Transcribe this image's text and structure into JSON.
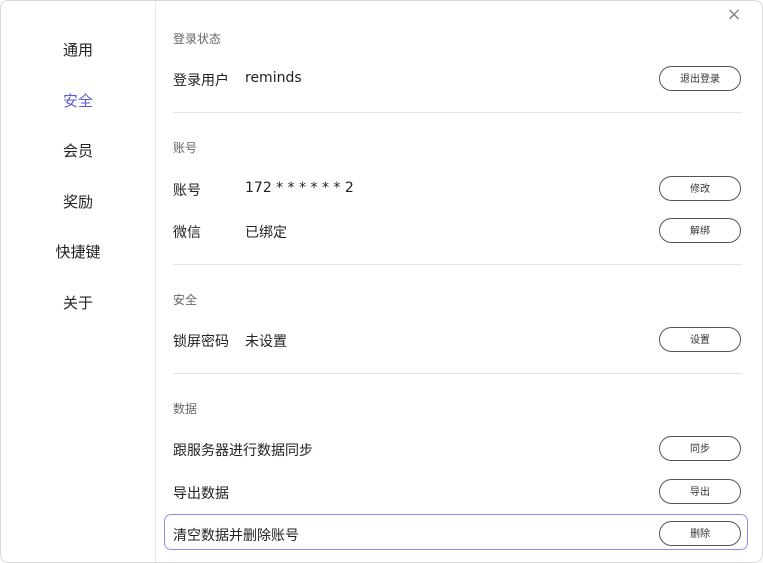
{
  "sidebar": {
    "items": [
      {
        "label": "通用",
        "active": false
      },
      {
        "label": "安全",
        "active": true
      },
      {
        "label": "会员",
        "active": false
      },
      {
        "label": "奖励",
        "active": false
      },
      {
        "label": "快捷键",
        "active": false
      },
      {
        "label": "关于",
        "active": false
      }
    ]
  },
  "close_icon": "×",
  "login": {
    "section_title": "登录状态",
    "user_label": "登录用户",
    "user_value": "reminds",
    "logout_button": "退出登录"
  },
  "account": {
    "section_title": "账号",
    "phone_label": "账号",
    "phone_value": "172 * * * * * * 2",
    "phone_button": "修改",
    "wechat_label": "微信",
    "wechat_value": "已绑定",
    "wechat_button": "解绑"
  },
  "security": {
    "section_title": "安全",
    "lock_label": "锁屏密码",
    "lock_value": "未设置",
    "lock_button": "设置"
  },
  "data": {
    "section_title": "数据",
    "sync_label": "跟服务器进行数据同步",
    "sync_button": "同步",
    "export_label": "导出数据",
    "export_button": "导出",
    "delete_label": "清空数据并删除账号",
    "delete_button": "删除"
  },
  "colors": {
    "accent": "#5b5bd6",
    "highlight_border": "#8d8df0"
  }
}
